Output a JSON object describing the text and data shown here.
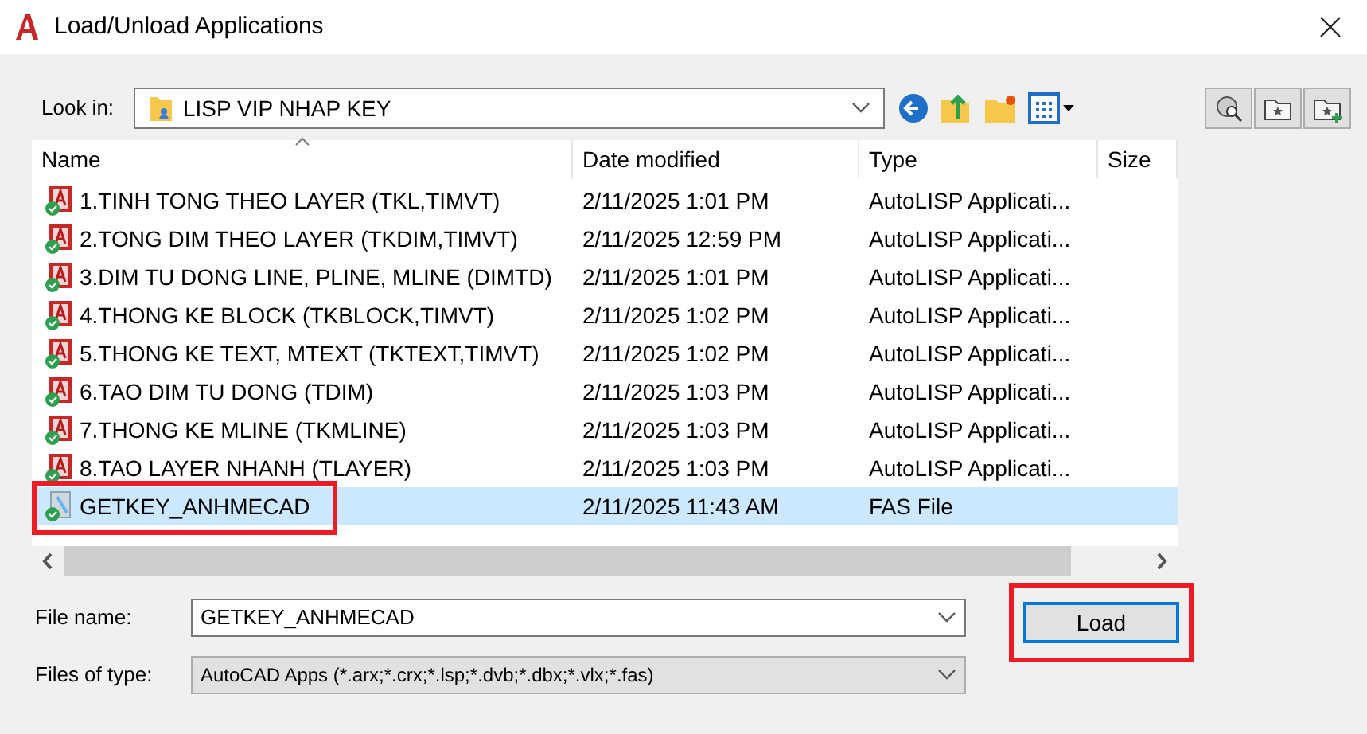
{
  "window": {
    "title": "Load/Unload Applications"
  },
  "look_in": {
    "label": "Look in:",
    "value": "LISP VIP NHAP KEY"
  },
  "columns": [
    "Name",
    "Date modified",
    "Type",
    "Size"
  ],
  "rows": [
    {
      "kind": "lsp",
      "name": "1.TINH TONG THEO LAYER (TKL,TIMVT)",
      "date": "2/11/2025 1:01 PM",
      "type": "AutoLISP Applicati...",
      "selected": false,
      "highlighted": false
    },
    {
      "kind": "lsp",
      "name": "2.TONG DIM THEO LAYER (TKDIM,TIMVT)",
      "date": "2/11/2025 12:59 PM",
      "type": "AutoLISP Applicati...",
      "selected": false,
      "highlighted": false
    },
    {
      "kind": "lsp",
      "name": "3.DIM TU DONG LINE, PLINE, MLINE (DIMTD)",
      "date": "2/11/2025 1:01 PM",
      "type": "AutoLISP Applicati...",
      "selected": false,
      "highlighted": false
    },
    {
      "kind": "lsp",
      "name": "4.THONG KE BLOCK (TKBLOCK,TIMVT)",
      "date": "2/11/2025 1:02 PM",
      "type": "AutoLISP Applicati...",
      "selected": false,
      "highlighted": false
    },
    {
      "kind": "lsp",
      "name": "5.THONG KE TEXT, MTEXT (TKTEXT,TIMVT)",
      "date": "2/11/2025 1:02 PM",
      "type": "AutoLISP Applicati...",
      "selected": false,
      "highlighted": false
    },
    {
      "kind": "lsp",
      "name": "6.TAO DIM TU DONG (TDIM)",
      "date": "2/11/2025 1:03 PM",
      "type": "AutoLISP Applicati...",
      "selected": false,
      "highlighted": false
    },
    {
      "kind": "lsp",
      "name": "7.THONG KE MLINE (TKMLINE)",
      "date": "2/11/2025 1:03 PM",
      "type": "AutoLISP Applicati...",
      "selected": false,
      "highlighted": false
    },
    {
      "kind": "lsp",
      "name": "8.TAO LAYER NHANH (TLAYER)",
      "date": "2/11/2025 1:03 PM",
      "type": "AutoLISP Applicati...",
      "selected": false,
      "highlighted": false
    },
    {
      "kind": "fas",
      "name": "GETKEY_ANHMECAD",
      "date": "2/11/2025 11:43 AM",
      "type": "FAS File",
      "selected": true,
      "highlighted": true
    }
  ],
  "file_name": {
    "label": "File name:",
    "value": "GETKEY_ANHMECAD"
  },
  "files_of_type": {
    "label": "Files of type:",
    "value": "AutoCAD Apps (*.arx;*.crx;*.lsp;*.dvb;*.dbx;*.vlx;*.fas)"
  },
  "load_button": {
    "label": "Load",
    "highlighted": true
  }
}
